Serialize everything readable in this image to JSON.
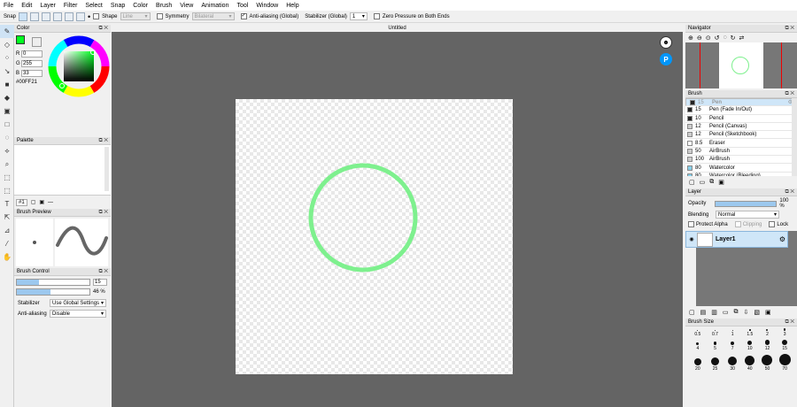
{
  "menu": [
    "File",
    "Edit",
    "Layer",
    "Filter",
    "Select",
    "Snap",
    "Color",
    "Brush",
    "View",
    "Animation",
    "Tool",
    "Window",
    "Help"
  ],
  "toolbar": {
    "snap_label": "Snap",
    "shape_label": "Shape",
    "shape_value": "Line",
    "symmetry_label": "Symmetry",
    "symmetry_value": "Bilateral",
    "antialias_label": "Anti-aliasing (Global)",
    "stabilizer_label": "Stabilizer (Global)",
    "stabilizer_value": "1",
    "zero_pressure_label": "Zero Pressure on Both Ends"
  },
  "canvas_tab": "Untitled",
  "color_panel": {
    "title": "Color",
    "r_label": "R",
    "r_value": "0",
    "g_label": "G",
    "g_value": "255",
    "b_label": "B",
    "b_value": "33",
    "hex": "#00FF21",
    "current_color": "#00ff21"
  },
  "palette_panel": {
    "title": "Palette",
    "page": "#1"
  },
  "brush_preview": {
    "title": "Brush Preview"
  },
  "brush_control": {
    "title": "Brush Control",
    "size_value": "15",
    "opacity_value": "46 %",
    "stabilizer_label": "Stabilizer",
    "stabilizer_value": "Use Global Settings",
    "antialias_label": "Anti-aliasing",
    "antialias_value": "Disable"
  },
  "navigator": {
    "title": "Navigator"
  },
  "brush_panel": {
    "title": "Brush",
    "items": [
      {
        "size": "15",
        "name": "Pen",
        "color": "#222222"
      },
      {
        "size": "15",
        "name": "Pen (Fade In/Out)",
        "color": "#222222"
      },
      {
        "size": "10",
        "name": "Pencil",
        "color": "#222222"
      },
      {
        "size": "12",
        "name": "Pencil (Canvas)",
        "color": "#cccccc"
      },
      {
        "size": "12",
        "name": "Pencil (Sketchbook)",
        "color": "#cccccc"
      },
      {
        "size": "8.5",
        "name": "Eraser",
        "color": "#ffffff"
      },
      {
        "size": "50",
        "name": "AirBrush",
        "color": "#cccccc"
      },
      {
        "size": "100",
        "name": "AirBrush",
        "color": "#cccccc"
      },
      {
        "size": "80",
        "name": "Watercolor",
        "color": "#87cfe8"
      },
      {
        "size": "80",
        "name": "Watercolor (Bleeding)",
        "color": "#87cfe8"
      }
    ]
  },
  "layer_panel": {
    "title": "Layer",
    "opacity_label": "Opacity",
    "opacity_value": "100 %",
    "blending_label": "Blending",
    "blending_value": "Normal",
    "protect_alpha": "Protect Alpha",
    "clipping": "Clipping",
    "lock": "Lock",
    "layer_name": "Layer1"
  },
  "brush_size_panel": {
    "title": "Brush Size",
    "sizes": [
      "0.5",
      "0.7",
      "1",
      "1.5",
      "2",
      "3",
      "4",
      "5",
      "7",
      "10",
      "12",
      "15",
      "20",
      "25",
      "30",
      "40",
      "50",
      "70"
    ]
  },
  "stroke_color": "#7ef08e"
}
